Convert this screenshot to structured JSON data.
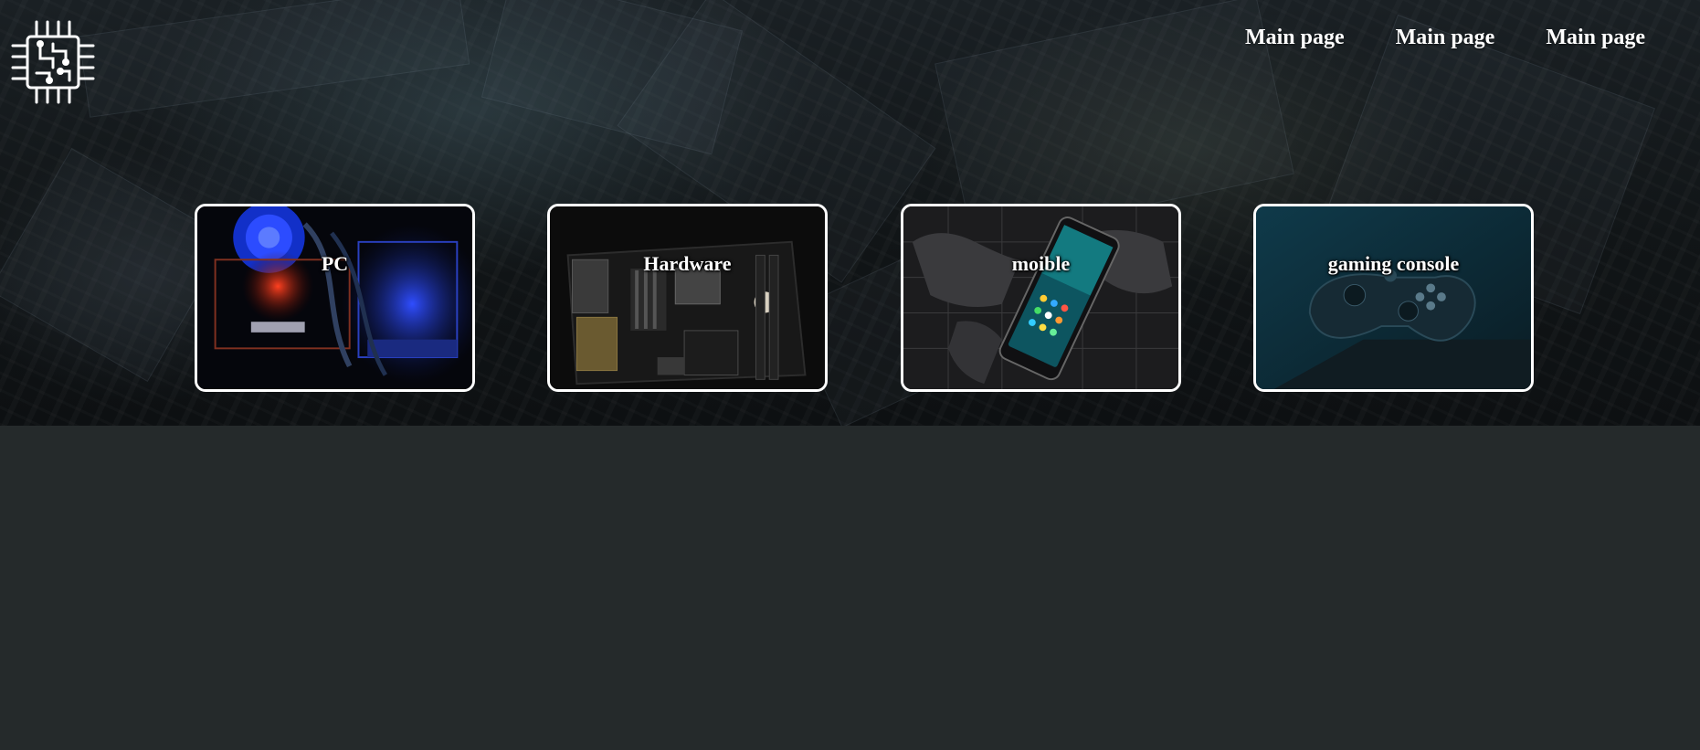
{
  "header": {
    "logo_icon": "circuit-chip-icon",
    "nav": [
      {
        "label": "Main page"
      },
      {
        "label": "Main page"
      },
      {
        "label": "Main page"
      }
    ]
  },
  "cards": [
    {
      "label": "PC",
      "image": "pc-interior-image"
    },
    {
      "label": "Hardware",
      "image": "motherboard-image"
    },
    {
      "label": "moible",
      "image": "smartphone-image"
    },
    {
      "label": "gaming console",
      "image": "game-controller-image"
    }
  ],
  "colors": {
    "page_background": "#252a2b",
    "card_border": "#ffffff",
    "text": "#ffffff"
  }
}
